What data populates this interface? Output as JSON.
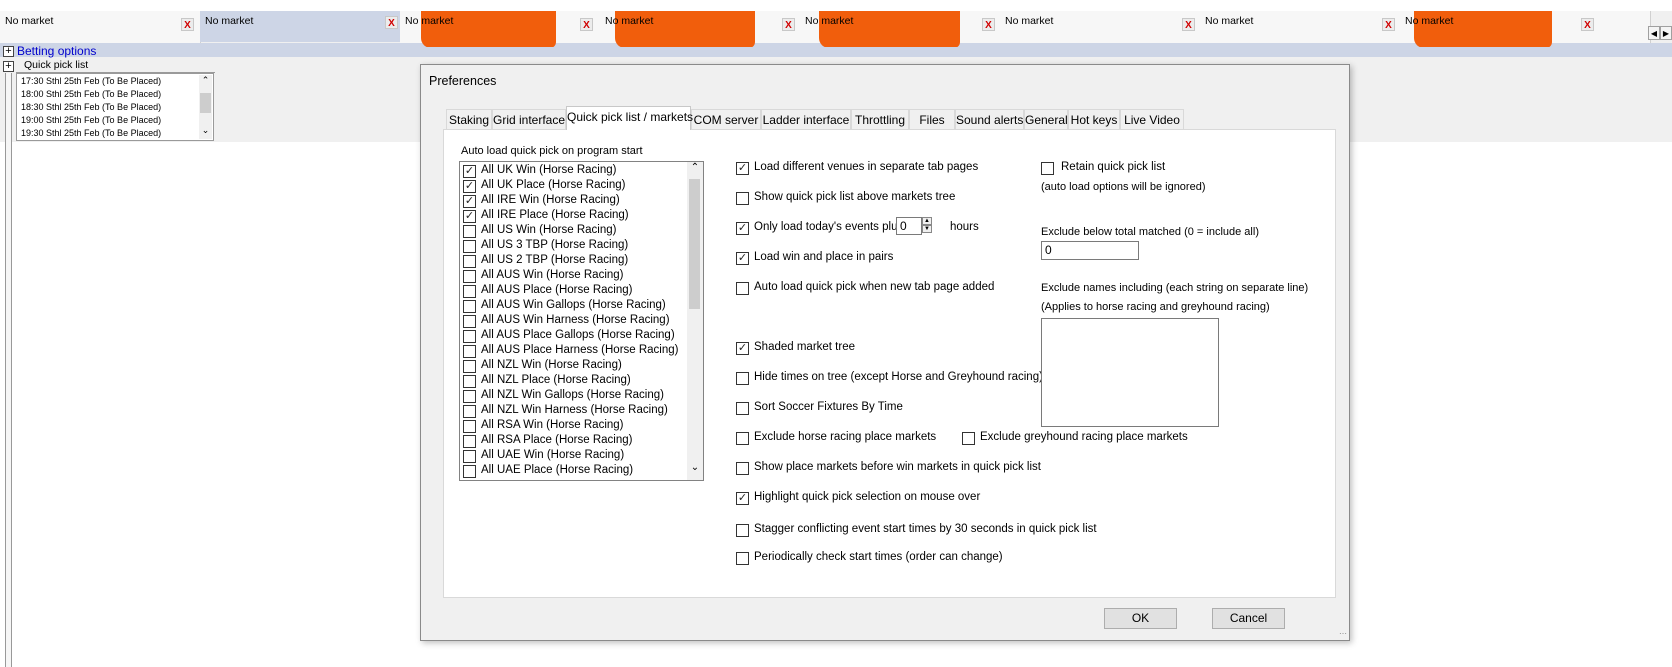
{
  "market_tabs": [
    {
      "label": "No market",
      "close": "X",
      "active": false
    },
    {
      "label": "No market",
      "close": "X",
      "active": true
    },
    {
      "label": "No market",
      "close": "X",
      "active": false
    },
    {
      "label": "No market",
      "close": "X",
      "active": false
    },
    {
      "label": "No market",
      "close": "X",
      "active": false
    },
    {
      "label": "No market",
      "close": "X",
      "active": false
    },
    {
      "label": "No market",
      "close": "X",
      "active": false
    },
    {
      "label": "No market",
      "close": "X",
      "active": false
    }
  ],
  "left_panel": {
    "betting_options": "Betting options",
    "quick_pick_title": "Quick pick list",
    "quick_pick_items": [
      "17:30 Sthl  25th Feb (To Be Placed)",
      "18:00 Sthl  25th Feb (To Be Placed)",
      "18:30 Sthl  25th Feb (To Be Placed)",
      "19:00 Sthl  25th Feb (To Be Placed)",
      "19:30 Sthl  25th Feb (To Be Placed)"
    ]
  },
  "dialog": {
    "title": "Preferences",
    "tabs": [
      "Staking",
      "Grid interface",
      "Quick pick list / markets",
      "COM server",
      "Ladder interface",
      "Throttling",
      "Files",
      "Sound alerts",
      "General",
      "Hot keys",
      "Live Video"
    ],
    "selected_tab": "Quick pick list / markets",
    "autoload_label": "Auto load quick pick on program start",
    "autoload_items": [
      {
        "label": "All UK Win (Horse Racing)",
        "checked": true
      },
      {
        "label": "All UK Place (Horse Racing)",
        "checked": true
      },
      {
        "label": "All IRE Win (Horse Racing)",
        "checked": true
      },
      {
        "label": "All IRE Place (Horse Racing)",
        "checked": true
      },
      {
        "label": "All US Win (Horse Racing)",
        "checked": false
      },
      {
        "label": "All US 3 TBP (Horse Racing)",
        "checked": false
      },
      {
        "label": "All US 2 TBP (Horse Racing)",
        "checked": false
      },
      {
        "label": "All AUS Win (Horse Racing)",
        "checked": false
      },
      {
        "label": "All AUS Place (Horse Racing)",
        "checked": false
      },
      {
        "label": "All AUS Win Gallops (Horse Racing)",
        "checked": false
      },
      {
        "label": "All AUS Win Harness (Horse Racing)",
        "checked": false
      },
      {
        "label": "All AUS Place Gallops (Horse Racing)",
        "checked": false
      },
      {
        "label": "All AUS Place Harness (Horse Racing)",
        "checked": false
      },
      {
        "label": "All NZL Win (Horse Racing)",
        "checked": false
      },
      {
        "label": "All NZL Place (Horse Racing)",
        "checked": false
      },
      {
        "label": "All NZL Win Gallops (Horse Racing)",
        "checked": false
      },
      {
        "label": "All NZL Win Harness (Horse Racing)",
        "checked": false
      },
      {
        "label": "All RSA Win (Horse Racing)",
        "checked": false
      },
      {
        "label": "All RSA Place (Horse Racing)",
        "checked": false
      },
      {
        "label": "All UAE Win (Horse Racing)",
        "checked": false
      },
      {
        "label": "All UAE Place (Horse Racing)",
        "checked": false
      }
    ],
    "options": {
      "load_venues_separate": {
        "label": "Load different venues in separate tab pages",
        "checked": true
      },
      "show_above_tree": {
        "label": "Show quick pick list above markets tree",
        "checked": false
      },
      "only_today": {
        "label": "Only load today's events plus",
        "checked": true,
        "value": "0",
        "suffix": "hours"
      },
      "win_place_pairs": {
        "label": "Load win and place in pairs",
        "checked": true
      },
      "autoload_new_tab": {
        "label": "Auto load quick pick when new tab page added",
        "checked": false
      },
      "shaded_tree": {
        "label": "Shaded market tree",
        "checked": true
      },
      "hide_times": {
        "label": "Hide times on tree (except Horse and Greyhound racing)",
        "checked": false
      },
      "sort_soccer": {
        "label": "Sort Soccer Fixtures By Time",
        "checked": false
      },
      "exclude_horse_place": {
        "label": "Exclude horse racing place markets",
        "checked": false
      },
      "exclude_grey_place": {
        "label": "Exclude greyhound racing place markets",
        "checked": false
      },
      "place_before_win": {
        "label": "Show place markets before win markets in quick pick list",
        "checked": false
      },
      "highlight_mouse": {
        "label": "Highlight quick pick selection on mouse over",
        "checked": true
      },
      "stagger": {
        "label": "Stagger conflicting event start times by 30 seconds in quick pick list",
        "checked": false
      },
      "periodic_check": {
        "label": "Periodically check start times (order can change)",
        "checked": false
      },
      "retain_list": {
        "label": "Retain quick pick list",
        "checked": false
      }
    },
    "retain_note": "(auto load options will be ignored)",
    "exclude_matched_label": "Exclude below total matched (0 = include all)",
    "exclude_matched_value": "0",
    "exclude_names_label": "Exclude names including (each string on separate line)",
    "exclude_names_note": "(Applies to horse racing and greyhound racing)",
    "exclude_names_value": "",
    "ok_label": "OK",
    "cancel_label": "Cancel"
  },
  "colors": {
    "redaction": "#f15e0c",
    "link_blue": "#0000cc",
    "highlight": "#cdd5e6"
  }
}
